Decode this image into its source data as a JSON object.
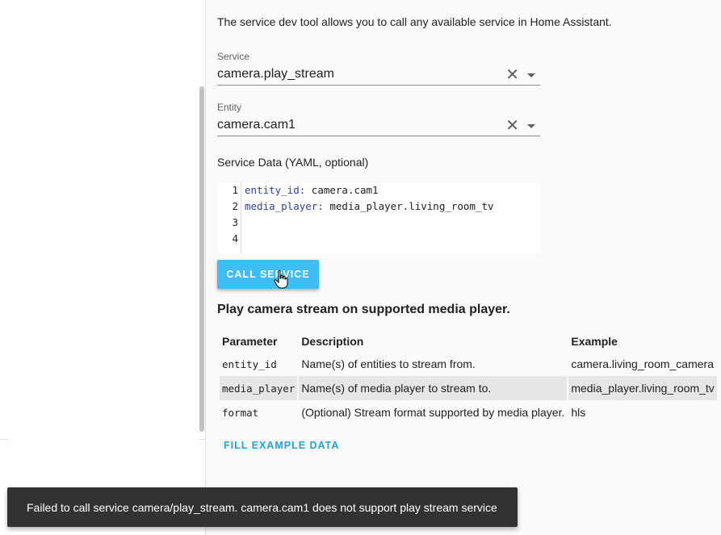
{
  "intro": "The service dev tool allows you to call any available service in Home Assistant.",
  "service_field": {
    "label": "Service",
    "value": "camera.play_stream"
  },
  "entity_field": {
    "label": "Entity",
    "value": "camera.cam1"
  },
  "yaml": {
    "label": "Service Data (YAML, optional)",
    "line_numbers": [
      "1",
      "2",
      "3",
      "4"
    ],
    "lines": [
      {
        "key": "entity_id:",
        "value": " camera.cam1"
      },
      {
        "key": "media_player:",
        "value": " media_player.living_room_tv"
      }
    ]
  },
  "call_button": "CALL SERVICE",
  "service_description": "Play camera stream on supported media player.",
  "table": {
    "headers": [
      "Parameter",
      "Description",
      "Example"
    ],
    "rows": [
      [
        "entity_id",
        "Name(s) of entities to stream from.",
        "camera.living_room_camera"
      ],
      [
        "media_player",
        "Name(s) of media player to stream to.",
        "media_player.living_room_tv"
      ],
      [
        "format",
        "(Optional) Stream format supported by media player.",
        "hls"
      ]
    ]
  },
  "fill_example": "FILL EXAMPLE DATA",
  "toast": "Failed to call service camera/play_stream. camera.cam1 does not support play stream service",
  "icons": {
    "clear": "close-icon",
    "dropdown": "chevron-down-icon",
    "cursor": "hand-pointer-icon"
  },
  "colors": {
    "accent": "#41bdf5",
    "link": "#1ca5e0",
    "toast_bg": "#323232",
    "yaml_key": "#2f3fa8"
  }
}
